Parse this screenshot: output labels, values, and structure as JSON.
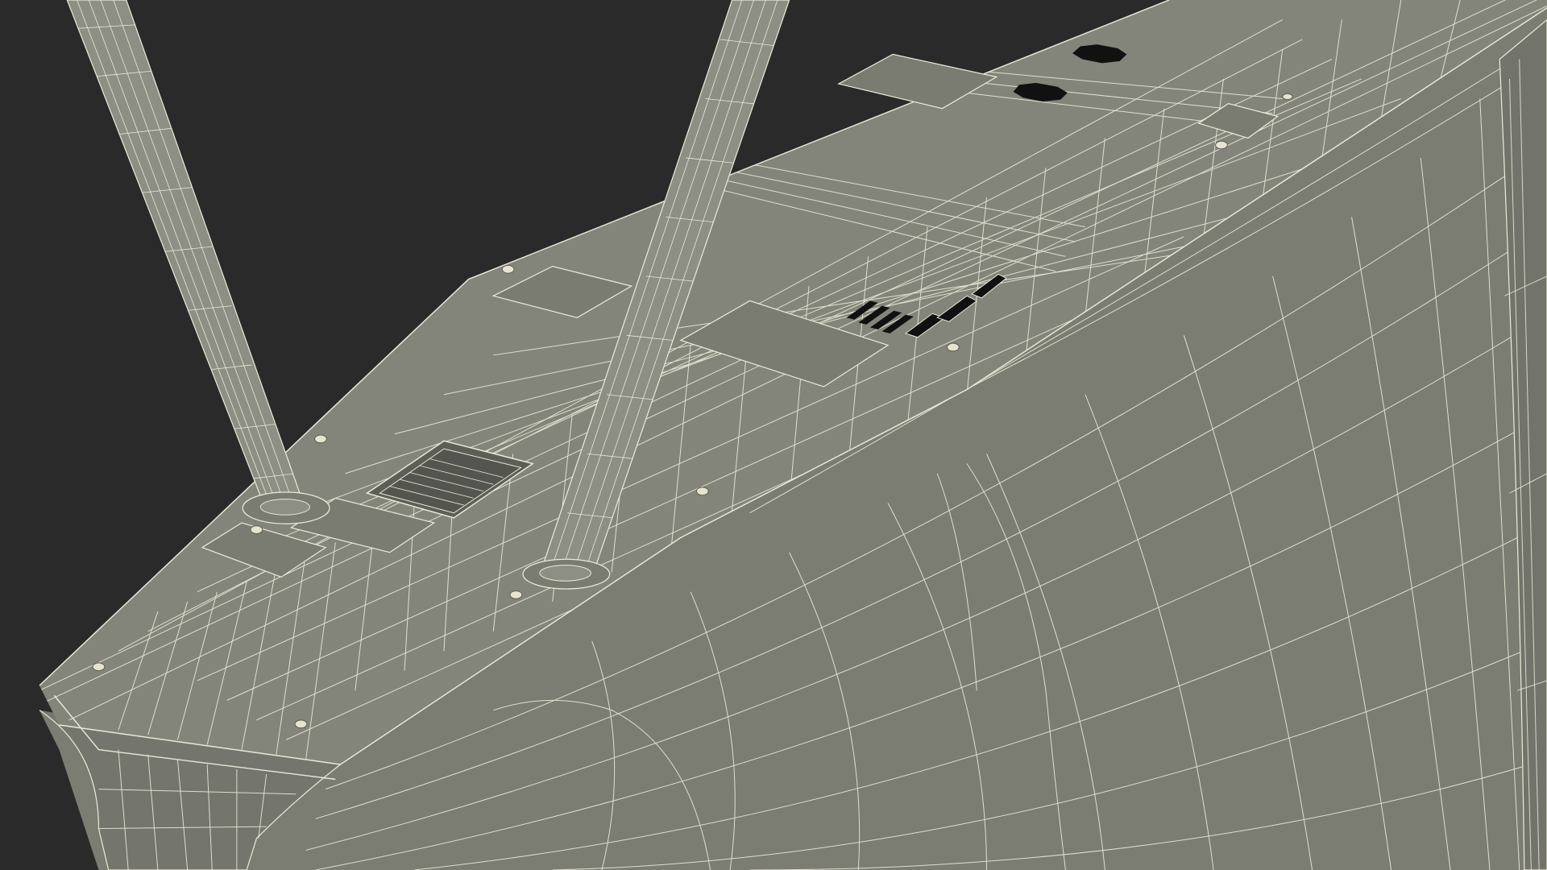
{
  "scene": {
    "subject": "router-wireframe-render",
    "colors": {
      "background": "#2a2a2a",
      "surface_top": "#83847a",
      "surface_front": "#7b7c72",
      "surface_dark": "#6f7067",
      "recess": "#5d5e56",
      "wire": "#e9ead8",
      "hole": "#111111",
      "antenna": "#8d8e84"
    }
  }
}
